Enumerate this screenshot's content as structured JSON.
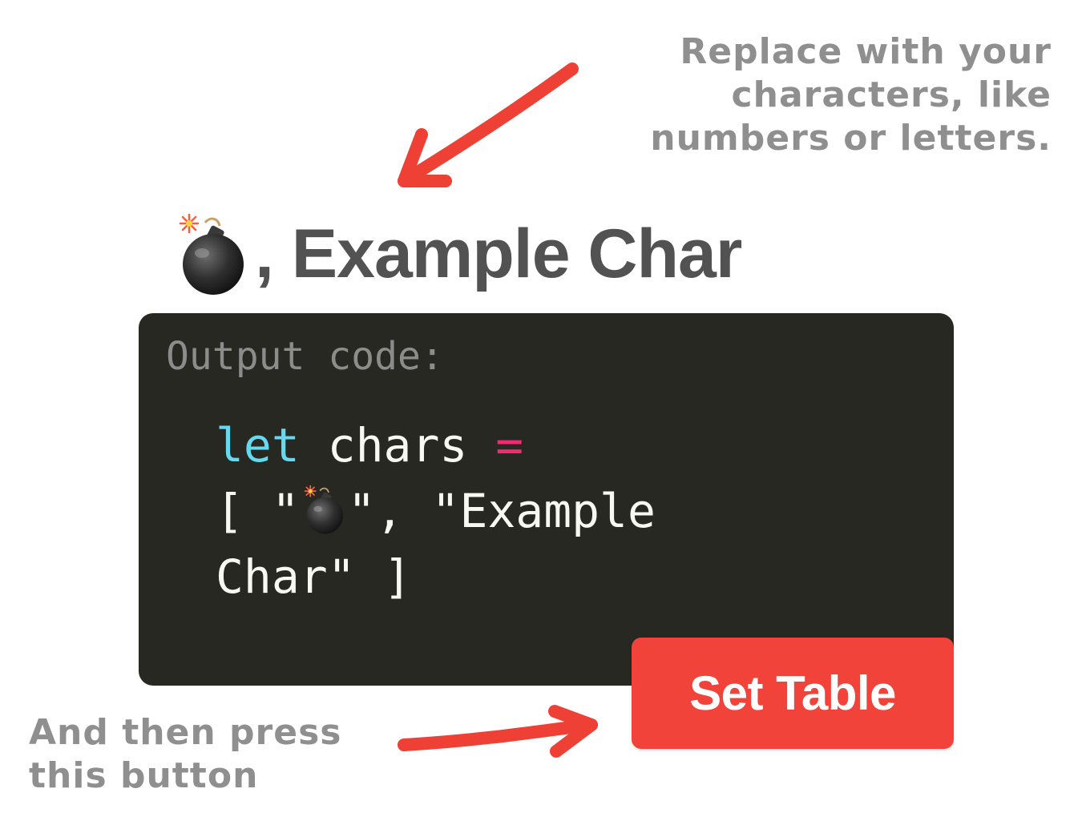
{
  "annotations": {
    "top_lines": [
      "Replace with your",
      "characters, like",
      "numbers or letters."
    ],
    "bottom_lines": [
      "And then press",
      "this button"
    ]
  },
  "title": {
    "icon": "bomb-icon",
    "text": ", Example Char"
  },
  "code_panel": {
    "label": "Output code:",
    "keyword": "let",
    "identifier": " chars ",
    "operator": "=",
    "line2_open": "[ \"",
    "line2_close": "\", \"Example",
    "line3": "Char\" ]"
  },
  "button": {
    "label": "Set Table"
  },
  "colors": {
    "arrow": "#ef4036",
    "button": "#f2433a",
    "panel": "#272822",
    "keyword": "#66d9ef",
    "operator": "#f92672",
    "annotation": "#8f8f8f"
  }
}
